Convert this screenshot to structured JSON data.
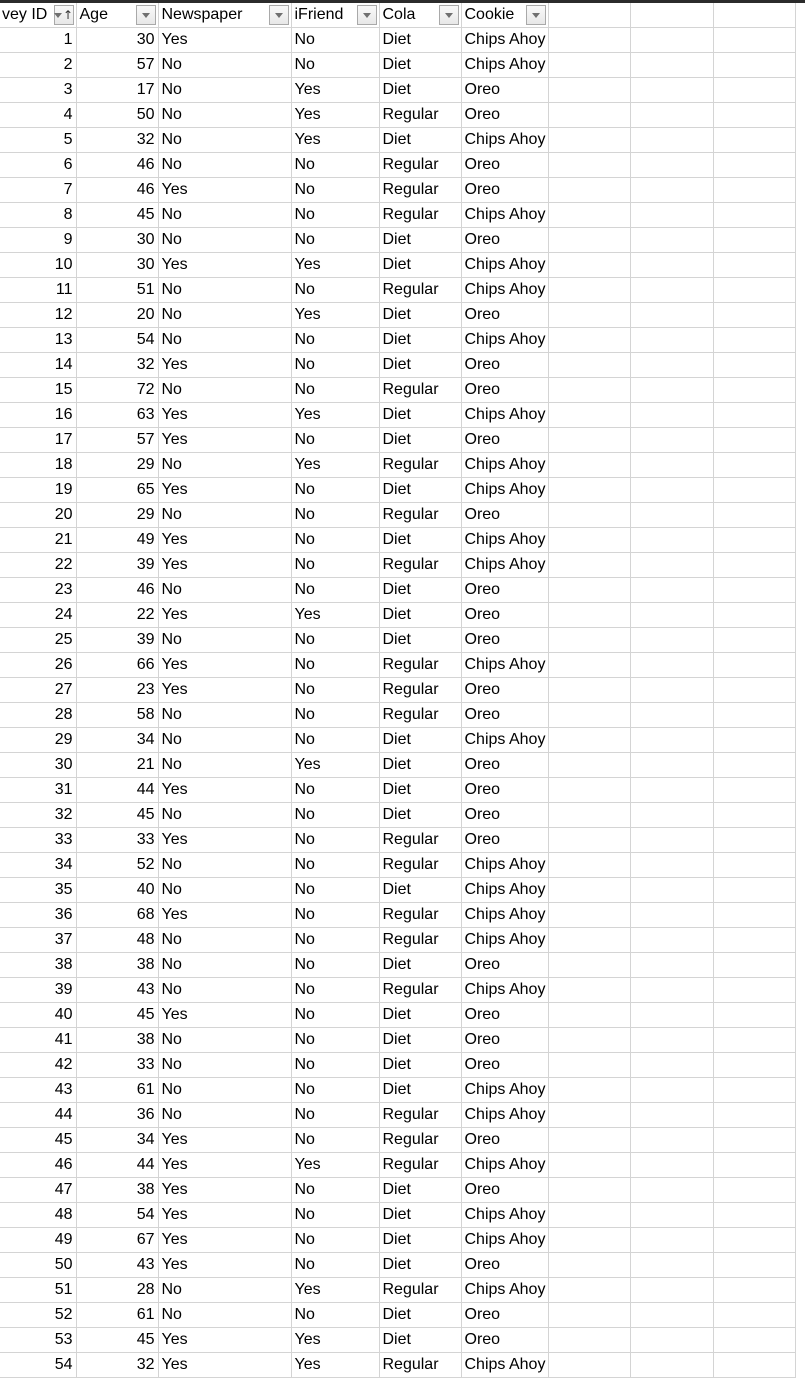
{
  "sheet": {
    "columns": [
      {
        "key": "id",
        "label": "vey ID",
        "sorted": "ascending"
      },
      {
        "key": "age",
        "label": "Age"
      },
      {
        "key": "newspaper",
        "label": "Newspaper"
      },
      {
        "key": "ifriend",
        "label": "iFriend"
      },
      {
        "key": "cola",
        "label": "Cola"
      },
      {
        "key": "cookie",
        "label": "Cookie"
      }
    ],
    "rows": [
      [
        "1",
        "30",
        "Yes",
        "No",
        "Diet",
        "Chips Ahoy"
      ],
      [
        "2",
        "57",
        "No",
        "No",
        "Diet",
        "Chips Ahoy"
      ],
      [
        "3",
        "17",
        "No",
        "Yes",
        "Diet",
        "Oreo"
      ],
      [
        "4",
        "50",
        "No",
        "Yes",
        "Regular",
        "Oreo"
      ],
      [
        "5",
        "32",
        "No",
        "Yes",
        "Diet",
        "Chips Ahoy"
      ],
      [
        "6",
        "46",
        "No",
        "No",
        "Regular",
        "Oreo"
      ],
      [
        "7",
        "46",
        "Yes",
        "No",
        "Regular",
        "Oreo"
      ],
      [
        "8",
        "45",
        "No",
        "No",
        "Regular",
        "Chips Ahoy"
      ],
      [
        "9",
        "30",
        "No",
        "No",
        "Diet",
        "Oreo"
      ],
      [
        "10",
        "30",
        "Yes",
        "Yes",
        "Diet",
        "Chips Ahoy"
      ],
      [
        "11",
        "51",
        "No",
        "No",
        "Regular",
        "Chips Ahoy"
      ],
      [
        "12",
        "20",
        "No",
        "Yes",
        "Diet",
        "Oreo"
      ],
      [
        "13",
        "54",
        "No",
        "No",
        "Diet",
        "Chips Ahoy"
      ],
      [
        "14",
        "32",
        "Yes",
        "No",
        "Diet",
        "Oreo"
      ],
      [
        "15",
        "72",
        "No",
        "No",
        "Regular",
        "Oreo"
      ],
      [
        "16",
        "63",
        "Yes",
        "Yes",
        "Diet",
        "Chips Ahoy"
      ],
      [
        "17",
        "57",
        "Yes",
        "No",
        "Diet",
        "Oreo"
      ],
      [
        "18",
        "29",
        "No",
        "Yes",
        "Regular",
        "Chips Ahoy"
      ],
      [
        "19",
        "65",
        "Yes",
        "No",
        "Diet",
        "Chips Ahoy"
      ],
      [
        "20",
        "29",
        "No",
        "No",
        "Regular",
        "Oreo"
      ],
      [
        "21",
        "49",
        "Yes",
        "No",
        "Diet",
        "Chips Ahoy"
      ],
      [
        "22",
        "39",
        "Yes",
        "No",
        "Regular",
        "Chips Ahoy"
      ],
      [
        "23",
        "46",
        "No",
        "No",
        "Diet",
        "Oreo"
      ],
      [
        "24",
        "22",
        "Yes",
        "Yes",
        "Diet",
        "Oreo"
      ],
      [
        "25",
        "39",
        "No",
        "No",
        "Diet",
        "Oreo"
      ],
      [
        "26",
        "66",
        "Yes",
        "No",
        "Regular",
        "Chips Ahoy"
      ],
      [
        "27",
        "23",
        "Yes",
        "No",
        "Regular",
        "Oreo"
      ],
      [
        "28",
        "58",
        "No",
        "No",
        "Regular",
        "Oreo"
      ],
      [
        "29",
        "34",
        "No",
        "No",
        "Diet",
        "Chips Ahoy"
      ],
      [
        "30",
        "21",
        "No",
        "Yes",
        "Diet",
        "Oreo"
      ],
      [
        "31",
        "44",
        "Yes",
        "No",
        "Diet",
        "Oreo"
      ],
      [
        "32",
        "45",
        "No",
        "No",
        "Diet",
        "Oreo"
      ],
      [
        "33",
        "33",
        "Yes",
        "No",
        "Regular",
        "Oreo"
      ],
      [
        "34",
        "52",
        "No",
        "No",
        "Regular",
        "Chips Ahoy"
      ],
      [
        "35",
        "40",
        "No",
        "No",
        "Diet",
        "Chips Ahoy"
      ],
      [
        "36",
        "68",
        "Yes",
        "No",
        "Regular",
        "Chips Ahoy"
      ],
      [
        "37",
        "48",
        "No",
        "No",
        "Regular",
        "Chips Ahoy"
      ],
      [
        "38",
        "38",
        "No",
        "No",
        "Diet",
        "Oreo"
      ],
      [
        "39",
        "43",
        "No",
        "No",
        "Regular",
        "Chips Ahoy"
      ],
      [
        "40",
        "45",
        "Yes",
        "No",
        "Diet",
        "Oreo"
      ],
      [
        "41",
        "38",
        "No",
        "No",
        "Diet",
        "Oreo"
      ],
      [
        "42",
        "33",
        "No",
        "No",
        "Diet",
        "Oreo"
      ],
      [
        "43",
        "61",
        "No",
        "No",
        "Diet",
        "Chips Ahoy"
      ],
      [
        "44",
        "36",
        "No",
        "No",
        "Regular",
        "Chips Ahoy"
      ],
      [
        "45",
        "34",
        "Yes",
        "No",
        "Regular",
        "Oreo"
      ],
      [
        "46",
        "44",
        "Yes",
        "Yes",
        "Regular",
        "Chips Ahoy"
      ],
      [
        "47",
        "38",
        "Yes",
        "No",
        "Diet",
        "Oreo"
      ],
      [
        "48",
        "54",
        "Yes",
        "No",
        "Diet",
        "Chips Ahoy"
      ],
      [
        "49",
        "67",
        "Yes",
        "No",
        "Diet",
        "Chips Ahoy"
      ],
      [
        "50",
        "43",
        "Yes",
        "No",
        "Diet",
        "Oreo"
      ],
      [
        "51",
        "28",
        "No",
        "Yes",
        "Regular",
        "Chips Ahoy"
      ],
      [
        "52",
        "61",
        "No",
        "No",
        "Diet",
        "Oreo"
      ],
      [
        "53",
        "45",
        "Yes",
        "Yes",
        "Diet",
        "Oreo"
      ],
      [
        "54",
        "32",
        "Yes",
        "Yes",
        "Regular",
        "Chips Ahoy"
      ]
    ]
  }
}
